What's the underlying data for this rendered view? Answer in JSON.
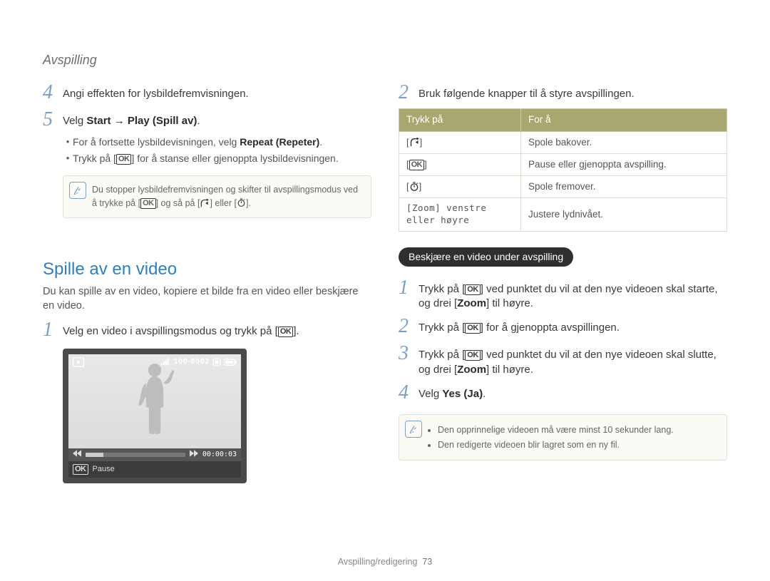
{
  "runningHead": "Avspilling",
  "left": {
    "step4": "Angi effekten for lysbildefremvisningen.",
    "step5_prefix": "Velg ",
    "step5_bold": "Start → Play (Spill av)",
    "step5_suffix": ".",
    "sub_bullets": [
      {
        "pre": "For å fortsette lysbildevisningen, velg ",
        "bold": "Repeat (Repeter)",
        "post": "."
      }
    ],
    "sub_bullet2_pre": "Trykk på [",
    "sub_bullet2_post": "] for å stanse eller gjenoppta lysbildevisningen.",
    "note1_a": "Du stopper lysbildefremvisningen og skifter til avspillingsmodus ved å trykke på [",
    "note1_b": "] og så på [",
    "note1_c": "] eller [",
    "note1_d": "].",
    "section_title": "Spille av en video",
    "section_para": "Du kan spille av en video, kopiere et bilde fra en video eller beskjære en video.",
    "play_step1_pre": "Velg en video i avspillingsmodus og trykk på [",
    "play_step1_post": "].",
    "vp_counter": "100-0002",
    "vp_time": "00:00:03",
    "vp_pause": "Pause"
  },
  "right": {
    "step2": "Bruk følgende knapper til å styre avspillingen.",
    "table": {
      "h1": "Trykk på",
      "h2": "For å",
      "rows": [
        {
          "k_icon": "rewind",
          "k": "",
          "v": "Spole bakover."
        },
        {
          "k_icon": "ok",
          "k": "",
          "v": "Pause eller gjenoppta avspilling."
        },
        {
          "k_icon": "forward",
          "k": "",
          "v": "Spole fremover."
        },
        {
          "k_icon": "",
          "k": "[Zoom] venstre eller høyre",
          "v": "Justere lydnivået."
        }
      ]
    },
    "pill": "Beskjære en video under avspilling",
    "trim1_pre": "Trykk på [",
    "trim1_mid": "] ved punktet du vil at den nye videoen skal starte, og drei [",
    "trim1_zoom": "Zoom",
    "trim1_post": "] til høyre.",
    "trim2_pre": "Trykk på [",
    "trim2_post": "] for å gjenoppta avspillingen.",
    "trim3_pre": "Trykk på [",
    "trim3_mid": "] ved punktet du vil at den nye videoen skal slutte, og drei [",
    "trim3_zoom": "Zoom",
    "trim3_post": "] til høyre.",
    "trim4_pre": "Velg ",
    "trim4_bold": "Yes (Ja)",
    "trim4_post": ".",
    "note2_items": [
      "Den opprinnelige videoen må være minst 10 sekunder lang.",
      "Den redigerte videoen blir lagret som en ny fil."
    ]
  },
  "footer_label": "Avspilling/redigering",
  "footer_page": "73",
  "ok_label": "OK"
}
